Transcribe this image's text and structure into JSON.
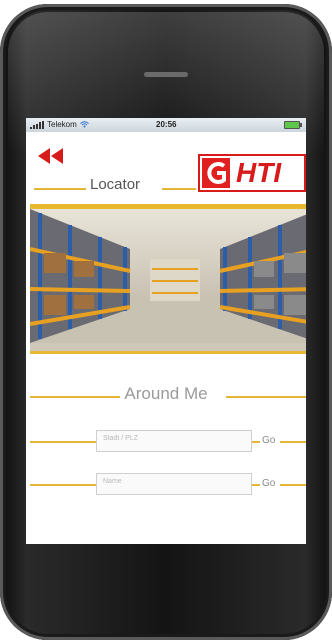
{
  "statusbar": {
    "carrier": "Telekom",
    "time": "20:56",
    "signal_icon": "signal-bars-icon",
    "wifi_icon": "wifi-icon",
    "battery_icon": "battery-icon"
  },
  "header": {
    "back_icon": "double-chevron-left-icon",
    "title": "Locator",
    "logo_text": "HTI"
  },
  "colors": {
    "accent_gold": "#e5b53a",
    "brand_red": "#d71a1a",
    "text_gray": "#9a9a9a"
  },
  "hero": {
    "subject": "warehouse-image"
  },
  "around_me": {
    "heading": "Around Me",
    "rows": [
      {
        "placeholder": "Stadt / PLZ",
        "go_label": "Go"
      },
      {
        "placeholder": "Name",
        "go_label": "Go"
      }
    ]
  }
}
